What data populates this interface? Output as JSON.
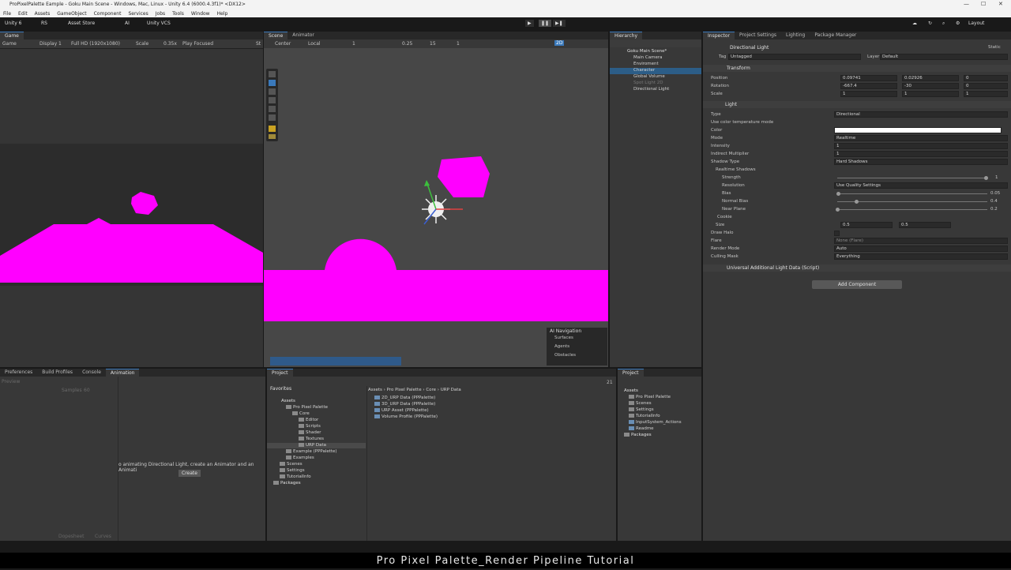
{
  "window": {
    "title": "ProPixelPalette Eample - Goku Main Scene - Windows, Mac, Linux - Unity 6.4 (6000.4.3f1)* <DX12>",
    "min": "—",
    "max": "☐",
    "close": "✕"
  },
  "menu": [
    "File",
    "Edit",
    "Assets",
    "GameObject",
    "Component",
    "Services",
    "Jobs",
    "Tools",
    "Window",
    "Help"
  ],
  "toolbar": {
    "account": "Unity 6",
    "rs": "RS",
    "asset_store": "Asset Store",
    "ai": "AI",
    "vcs": "Unity VCS",
    "layout": "Layout",
    "play": "▶",
    "pause": "❚❚",
    "step": "▶❚"
  },
  "game": {
    "tab": "Game",
    "mode": "Game",
    "display": "Display 1",
    "resolution": "Full HD (1920x1080)",
    "scale_label": "Scale",
    "scale_value": "0.35x",
    "play_focused": "Play Focused",
    "stats": "St"
  },
  "scene": {
    "tab_scene": "Scene",
    "tab_animator": "Animator",
    "pivot": "Center",
    "space": "Local",
    "grid_val": "1",
    "snap_val": "0.25",
    "angle_val": "15",
    "scale_snap": "1",
    "mode_2d": "2D",
    "overlay_title": "AI Navigation",
    "overlay_items": [
      "Surfaces",
      "Agents",
      "Obstacles"
    ]
  },
  "hierarchy": {
    "tab": "Hierarchy",
    "scene": "Goku Main Scene*",
    "items": [
      "Main Camera",
      "Enviroment",
      "Character",
      "Global Volume",
      "Spot Light 2D",
      "Directional Light"
    ]
  },
  "inspector": {
    "tabs": [
      "Inspector",
      "Project Settings",
      "Lighting",
      "Package Manager"
    ],
    "object_name": "Directional Light",
    "static_label": "Static",
    "tag_label": "Tag",
    "tag_value": "Untagged",
    "layer_label": "Layer",
    "layer_value": "Default",
    "transform": {
      "title": "Transform",
      "position": {
        "label": "Position",
        "x": "0.09741",
        "y": "0.02926",
        "z": "0"
      },
      "rotation": {
        "label": "Rotation",
        "x": "-667.4",
        "y": "-30",
        "z": "0"
      },
      "scale": {
        "label": "Scale",
        "x": "1",
        "y": "1",
        "z": "1"
      }
    },
    "light": {
      "title": "Light",
      "rows": [
        {
          "label": "Type",
          "value": "Directional"
        },
        {
          "label": "Use color temperature mode",
          "value": ""
        },
        {
          "label": "Color",
          "value": ""
        },
        {
          "label": "Mode",
          "value": "Realtime"
        },
        {
          "label": "Intensity",
          "value": "1"
        },
        {
          "label": "Indirect Multiplier",
          "value": "1"
        },
        {
          "label": "Shadow Type",
          "value": "Hard Shadows"
        }
      ],
      "realtime_shadows": "Realtime Shadows",
      "strength": {
        "label": "Strength",
        "value": "1",
        "fraction": 1.0
      },
      "resolution": {
        "label": "Resolution",
        "value": "Use Quality Settings"
      },
      "bias": {
        "label": "Bias",
        "value": "0.05",
        "fraction": 0.025
      },
      "normal_bias": {
        "label": "Normal Bias",
        "value": "0.4",
        "fraction": 0.133
      },
      "near_plane": {
        "label": "Near Plane",
        "value": "0.2",
        "fraction": 0.0
      },
      "cookie": "Cookie",
      "size": {
        "label": "Size",
        "x": "0.5",
        "y": "0.5"
      },
      "draw_halo": "Draw Halo",
      "flare": {
        "label": "Flare",
        "value": "None (Flare)"
      },
      "render_mode": {
        "label": "Render Mode",
        "value": "Auto"
      },
      "culling_mask": {
        "label": "Culling Mask",
        "value": "Everything"
      }
    },
    "urp_component": "Universal Additional Light Data (Script)",
    "add_component": "Add Component"
  },
  "bottom_left": {
    "tabs": [
      "Preferences",
      "Build Profiles",
      "Console",
      "Animation"
    ],
    "preview": "Preview",
    "samples_label": "Samples",
    "samples_value": "60",
    "message": "o animating Directional Light, create an Animator and an Animati",
    "create": "Create",
    "dopesheet": "Dopesheet",
    "curves": "Curves"
  },
  "project": {
    "tab": "Project",
    "favorites": "Favorites",
    "tree": [
      "Assets",
      "Pro Pixel Palette",
      "Core",
      "Editor",
      "Scripts",
      "Shader",
      "Textures",
      "URP Data",
      "Example (PPPalette)",
      "Examples",
      "Scenes",
      "Settings",
      "TutorialInfo",
      "Packages"
    ],
    "breadcrumb": [
      "Assets",
      "Pro Pixel Palette",
      "Core",
      "URP Data"
    ],
    "files": [
      "2D_URP Data (PPPalette)",
      "3D_URP Data (PPPalette)",
      "URP Asset (PPPalette)",
      "Volume Profile (PPPalette)"
    ],
    "count": "21"
  },
  "project2": {
    "tab": "Project",
    "tree": [
      "Assets",
      "Pro Pixel Palette",
      "Scenes",
      "Settings",
      "TutorialInfo",
      "InputSystem_Actions",
      "Readme",
      "Packages"
    ]
  },
  "caption": "Pro Pixel Palette_Render Pipeline Tutorial",
  "colors": {
    "magenta": "#ff00ff",
    "selection": "#2c5d87",
    "accent": "#3a79bb"
  }
}
